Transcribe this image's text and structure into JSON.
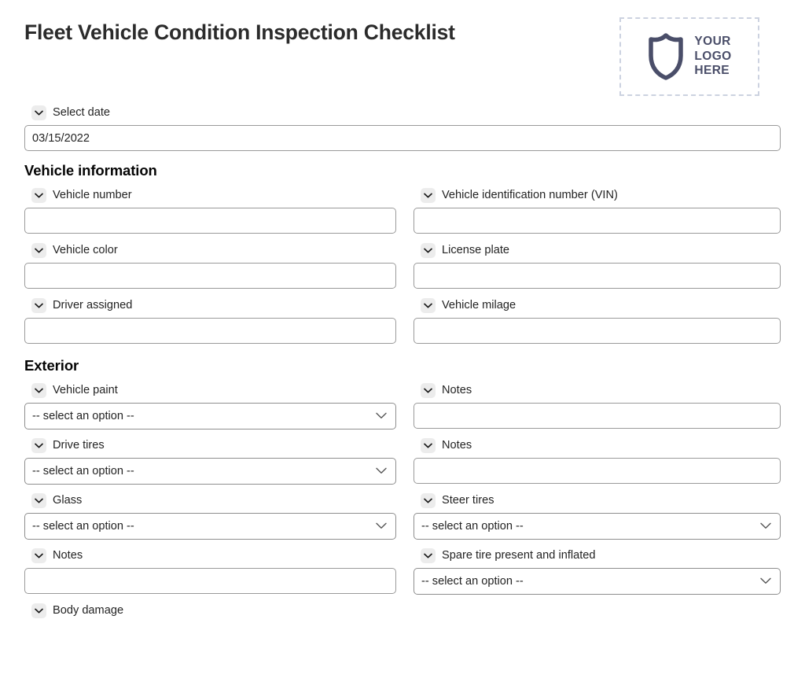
{
  "header": {
    "title": "Fleet Vehicle Condition Inspection Checklist",
    "logo": {
      "line1": "YOUR",
      "line2": "LOGO",
      "line3": "HERE",
      "icon": "shield-icon",
      "border_color": "#ccd2e0",
      "shield_color": "#4a4e69"
    }
  },
  "date_field": {
    "label": "Select date",
    "value": "03/15/2022",
    "icon": "chevron-down-icon"
  },
  "select_placeholder": "-- select an option --",
  "text_placeholder": "",
  "sections": [
    {
      "heading": "Vehicle information",
      "fields": [
        {
          "label": "Vehicle number",
          "type": "text",
          "value": "",
          "col": "left"
        },
        {
          "label": "Vehicle identification number (VIN)",
          "type": "text",
          "value": "",
          "col": "right"
        },
        {
          "label": "Vehicle color",
          "type": "text",
          "value": "",
          "col": "left"
        },
        {
          "label": "License plate",
          "type": "text",
          "value": "",
          "col": "right"
        },
        {
          "label": "Driver assigned",
          "type": "text",
          "value": "",
          "col": "left"
        },
        {
          "label": "Vehicle milage",
          "type": "text",
          "value": "",
          "col": "right"
        }
      ]
    },
    {
      "heading": "Exterior",
      "fields": [
        {
          "label": "Vehicle paint",
          "type": "select",
          "value": "-- select an option --",
          "col": "left"
        },
        {
          "label": "Notes",
          "type": "text",
          "value": "",
          "col": "right"
        },
        {
          "label": "Drive tires",
          "type": "select",
          "value": "-- select an option --",
          "col": "left"
        },
        {
          "label": "Notes",
          "type": "text",
          "value": "",
          "col": "right"
        },
        {
          "label": "Glass",
          "type": "select",
          "value": "-- select an option --",
          "col": "left"
        },
        {
          "label": "Steer tires",
          "type": "select",
          "value": "-- select an option --",
          "col": "right"
        },
        {
          "label": "Notes",
          "type": "text",
          "value": "",
          "col": "left"
        },
        {
          "label": "Spare tire present and inflated",
          "type": "select",
          "value": "-- select an option --",
          "col": "right"
        },
        {
          "label": "Body damage",
          "type": "cutoff",
          "value": "",
          "col": "left"
        }
      ]
    }
  ]
}
